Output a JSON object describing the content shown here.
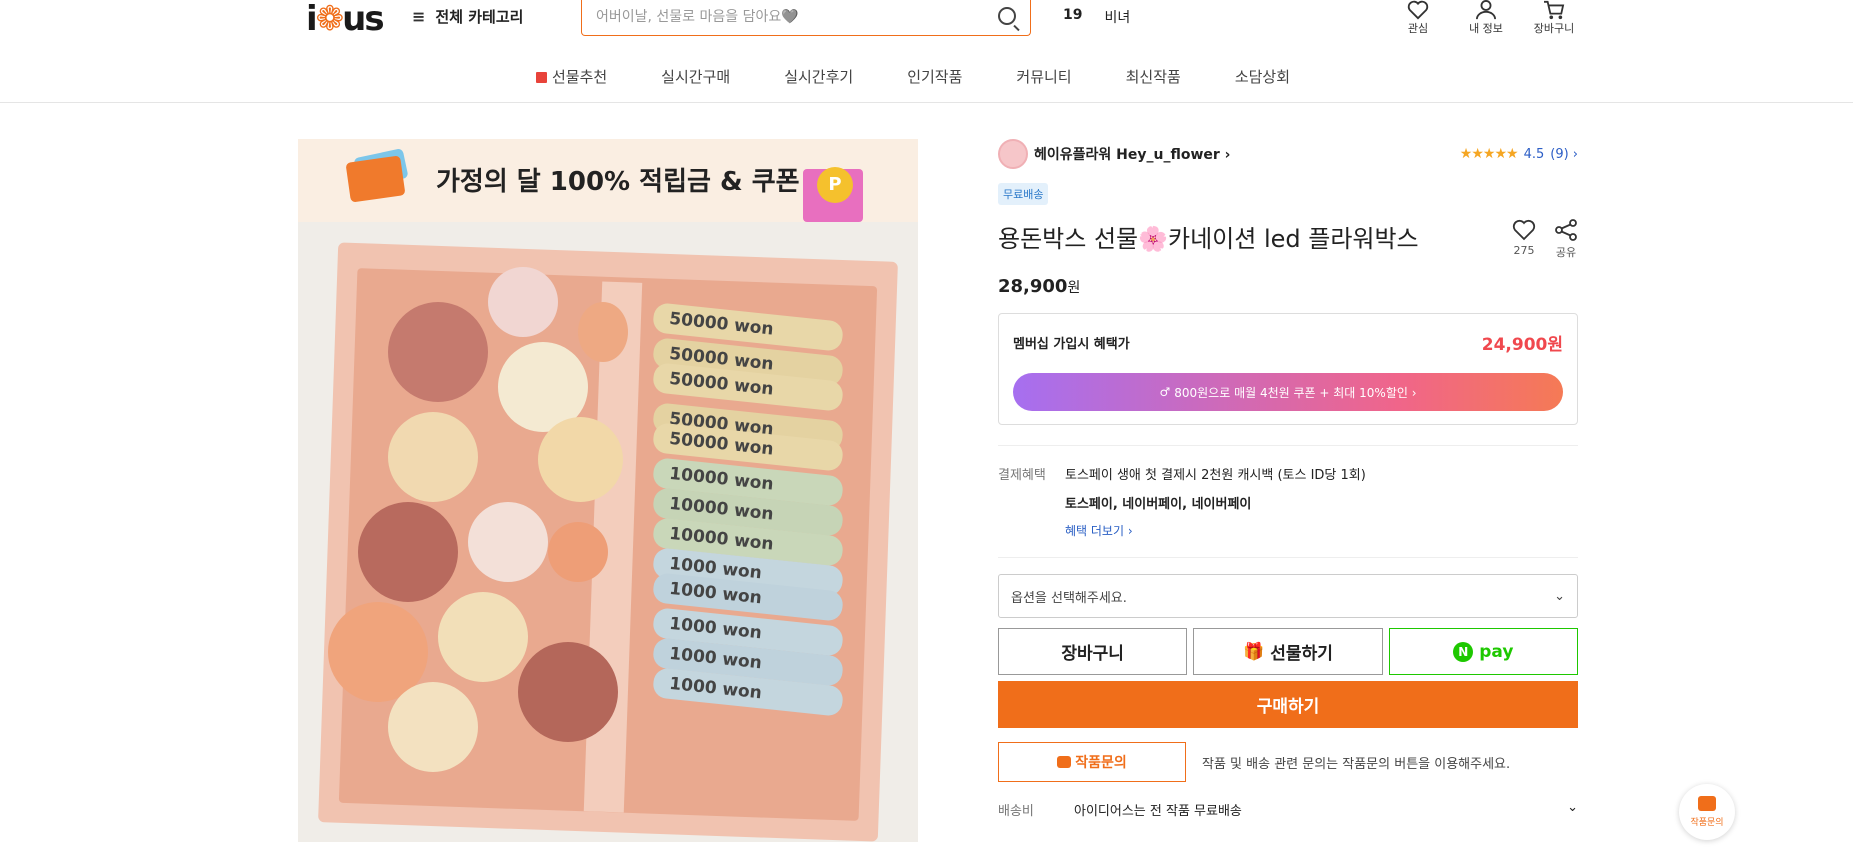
{
  "header": {
    "logo": {
      "pre": "i",
      "mid": "❁",
      "post": "us"
    },
    "category_label": "전체 카테고리",
    "search_placeholder": "어버이날, 선물로 마음을 담아요🩶",
    "popular": {
      "rank": "19",
      "keyword": "비녀"
    },
    "icons": [
      {
        "label": "관심",
        "icon": "heart-icon"
      },
      {
        "label": "내 정보",
        "icon": "user-icon"
      },
      {
        "label": "장바구니",
        "icon": "cart-icon"
      }
    ]
  },
  "nav": [
    "선물추천",
    "실시간구매",
    "실시간후기",
    "인기작품",
    "커뮤니티",
    "최신작품",
    "소담상회"
  ],
  "banner": {
    "text": "가정의 달 100% 적립금 & 쿠폰",
    "coin": "P"
  },
  "product": {
    "bills": [
      "50000 won",
      "50000 won",
      "50000 won",
      "50000 won",
      "50000 won",
      "10000 won",
      "10000 won",
      "10000 won",
      "1000 won",
      "1000 won",
      "1000 won",
      "1000 won",
      "1000 won"
    ]
  },
  "shop": {
    "seller_name": "헤이유플라워 Hey_u_flower ›",
    "stars": "★★★★★",
    "rating": "4.5",
    "review_count": "(9) ›",
    "badge": "무료배송",
    "title": "용돈박스 선물🌸카네이션 led 플라워박스",
    "like_count": "275",
    "share_label": "공유",
    "price": "28,900",
    "price_unit": "원",
    "membership_label": "멤버십 가입시 혜택가",
    "membership_price": "24,900원",
    "membership_banner": "800원으로 매월 4천원 쿠폰 + 최대 10%할인 ›",
    "benefit_label": "결제혜택",
    "benefit_line1": "토스페이 생애 첫 결제시 2천원 캐시백 (토스 ID당 1회)",
    "benefit_line2": "토스페이, 네이버페이, 네이버페이",
    "benefit_more": "혜택 더보기 ›",
    "option_placeholder": "옵션을 선택해주세요.",
    "cart_button": "장바구니",
    "gift_button": "선물하기",
    "npay_label": "pay",
    "npay_mark": "N",
    "buy_button": "구매하기",
    "inquiry_button": "작품문의",
    "inquiry_text": "작품 및 배송 관련 문의는 작품문의 버튼을 이용해주세요.",
    "shipping_label": "배송비",
    "shipping_value": "아이디어스는 전 작품 무료배송"
  },
  "fab": {
    "label": "작품문의"
  }
}
